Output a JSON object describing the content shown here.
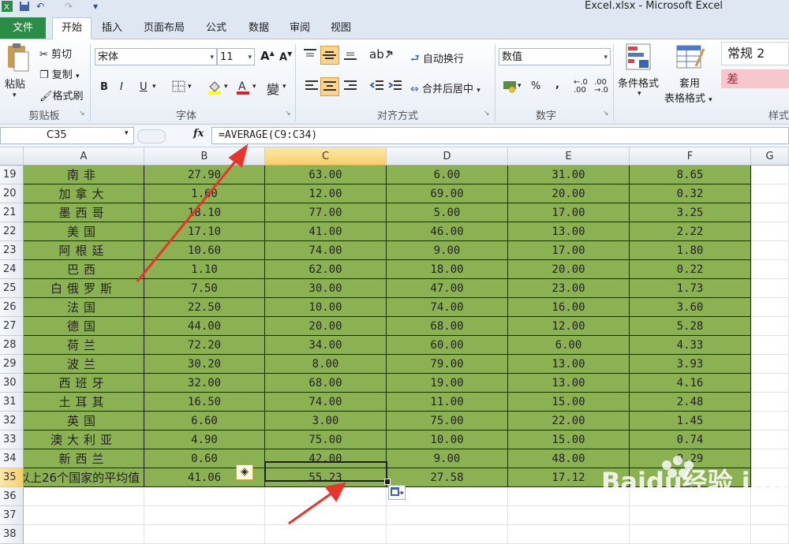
{
  "window": {
    "title": "Excel.xlsx - Microsoft Excel"
  },
  "tabs": [
    "文件",
    "开始",
    "插入",
    "页面布局",
    "公式",
    "数据",
    "审阅",
    "视图"
  ],
  "ribbon": {
    "clipboard": {
      "paste": "粘贴",
      "cut": "剪切",
      "copy": "复制",
      "format_painter": "格式刷",
      "label": "剪贴板"
    },
    "font": {
      "name": "宋体",
      "size": "11",
      "bold": "B",
      "italic": "I",
      "underline": "U",
      "grow": "A",
      "shrink": "A",
      "label": "字体"
    },
    "alignment": {
      "wrap": "自动换行",
      "merge": "合并后居中",
      "label": "对齐方式"
    },
    "number": {
      "format": "数值",
      "percent": "%",
      "comma": ",",
      "label": "数字"
    },
    "styles": {
      "conditional": "条件格式",
      "table_line1": "套用",
      "table_line2": "表格格式",
      "normal": "常规 2",
      "bad": "差",
      "label": "样式"
    }
  },
  "formula_bar": {
    "name_box": "C35",
    "fx": "fx",
    "formula": "=AVERAGE(C9:C34)"
  },
  "columns": [
    "A",
    "B",
    "C",
    "D",
    "E",
    "F",
    "G"
  ],
  "rows": [
    {
      "n": "19",
      "a": "南非",
      "b": "27.90",
      "c": "63.00",
      "d": "6.00",
      "e": "31.00",
      "f": "8.65"
    },
    {
      "n": "20",
      "a": "加拿大",
      "b": "1.60",
      "c": "12.00",
      "d": "69.00",
      "e": "20.00",
      "f": "0.32"
    },
    {
      "n": "21",
      "a": "墨西哥",
      "b": "18.10",
      "c": "77.00",
      "d": "5.00",
      "e": "17.00",
      "f": "3.25"
    },
    {
      "n": "22",
      "a": "美国",
      "b": "17.10",
      "c": "41.00",
      "d": "46.00",
      "e": "13.00",
      "f": "2.22"
    },
    {
      "n": "23",
      "a": "阿根廷",
      "b": "10.60",
      "c": "74.00",
      "d": "9.00",
      "e": "17.00",
      "f": "1.80"
    },
    {
      "n": "24",
      "a": "巴西",
      "b": "1.10",
      "c": "62.00",
      "d": "18.00",
      "e": "20.00",
      "f": "0.22"
    },
    {
      "n": "25",
      "a": "白俄罗斯",
      "b": "7.50",
      "c": "30.00",
      "d": "47.00",
      "e": "23.00",
      "f": "1.73"
    },
    {
      "n": "26",
      "a": "法国",
      "b": "22.50",
      "c": "10.00",
      "d": "74.00",
      "e": "16.00",
      "f": "3.60"
    },
    {
      "n": "27",
      "a": "德国",
      "b": "44.00",
      "c": "20.00",
      "d": "68.00",
      "e": "12.00",
      "f": "5.28"
    },
    {
      "n": "28",
      "a": "荷兰",
      "b": "72.20",
      "c": "34.00",
      "d": "60.00",
      "e": "6.00",
      "f": "4.33"
    },
    {
      "n": "29",
      "a": "波兰",
      "b": "30.20",
      "c": "8.00",
      "d": "79.00",
      "e": "13.00",
      "f": "3.93"
    },
    {
      "n": "30",
      "a": "西班牙",
      "b": "32.00",
      "c": "68.00",
      "d": "19.00",
      "e": "13.00",
      "f": "4.16"
    },
    {
      "n": "31",
      "a": "土耳其",
      "b": "16.50",
      "c": "74.00",
      "d": "11.00",
      "e": "15.00",
      "f": "2.48"
    },
    {
      "n": "32",
      "a": "英国",
      "b": "6.60",
      "c": "3.00",
      "d": "75.00",
      "e": "22.00",
      "f": "1.45"
    },
    {
      "n": "33",
      "a": "澳大利亚",
      "b": "4.90",
      "c": "75.00",
      "d": "10.00",
      "e": "15.00",
      "f": "0.74"
    },
    {
      "n": "34",
      "a": "新西兰",
      "b": "0.60",
      "c": "42.00",
      "d": "9.00",
      "e": "48.00",
      "f": "0.29"
    },
    {
      "n": "35",
      "a": "以上26个国家的平均值",
      "b": "41.06",
      "c": "55.23",
      "d": "27.58",
      "e": "17.12",
      "f": ""
    }
  ],
  "empty_rows": [
    "36",
    "37",
    "38"
  ],
  "watermark": "Baidu经验 jingyan.baidu.com",
  "colors": {
    "cell_green": "#8cb152",
    "file_tab": "#2a8c46",
    "annotation_red": "#e8342a"
  }
}
